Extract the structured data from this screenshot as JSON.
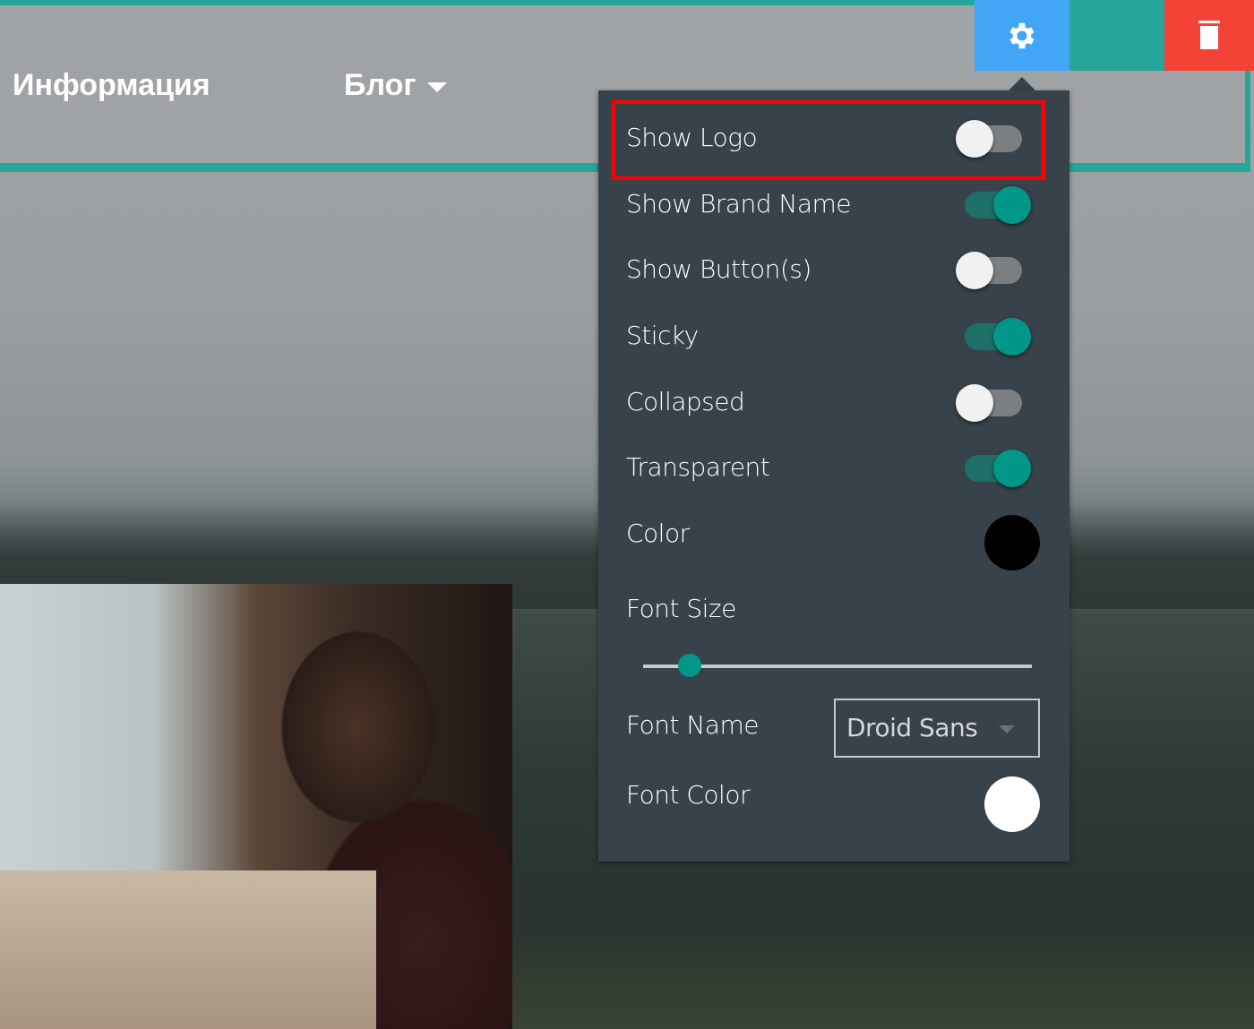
{
  "nav": {
    "items": [
      {
        "label": "Информация"
      },
      {
        "label": "Блог",
        "has_dropdown": true
      }
    ]
  },
  "toolbar": {
    "settings_icon": "gear-icon",
    "move_icon": "move-icon",
    "delete_icon": "trash-icon",
    "settings_color": "#42a5f5",
    "move_color": "#26a69a",
    "delete_color": "#f44336"
  },
  "panel": {
    "toggles": [
      {
        "label": "Show Logo",
        "on": false
      },
      {
        "label": "Show Brand Name",
        "on": true
      },
      {
        "label": "Show Button(s)",
        "on": false
      },
      {
        "label": "Sticky",
        "on": true
      },
      {
        "label": "Collapsed",
        "on": false
      },
      {
        "label": "Transparent",
        "on": true
      }
    ],
    "color": {
      "label": "Color",
      "value": "#000000"
    },
    "font_size": {
      "label": "Font Size",
      "value_percent": 12
    },
    "font_name": {
      "label": "Font Name",
      "value": "Droid Sans"
    },
    "font_color": {
      "label": "Font Color",
      "value": "#ffffff"
    }
  }
}
